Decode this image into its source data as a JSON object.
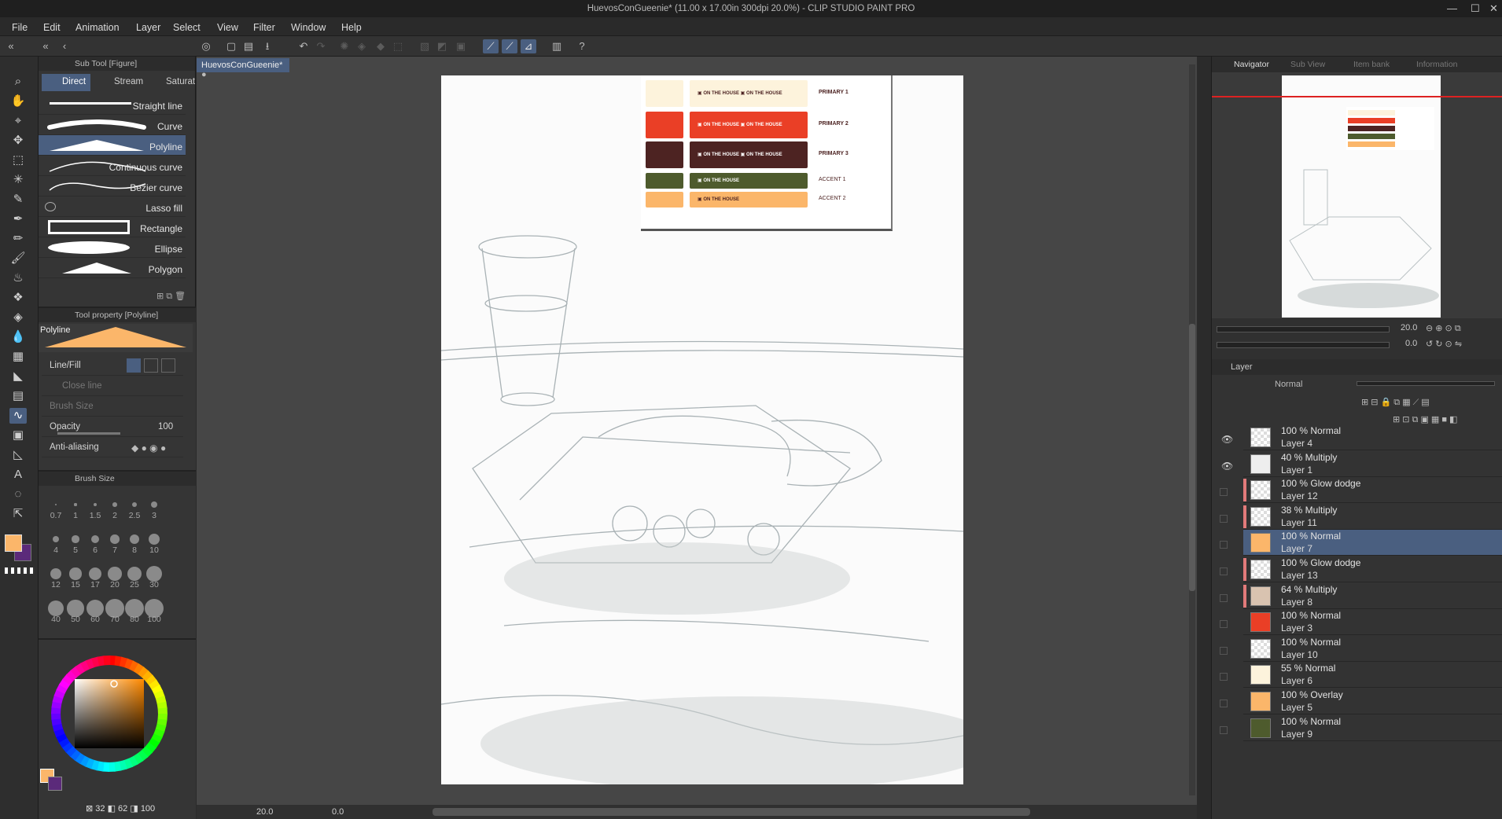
{
  "window": {
    "title": "HuevosConGueenie* (11.00 x 17.00in 300dpi 20.0%) - CLIP STUDIO PAINT PRO"
  },
  "menu": [
    "File",
    "Edit",
    "Animation",
    "Layer",
    "Select",
    "View",
    "Filter",
    "Window",
    "Help"
  ],
  "subtool": {
    "title": "Sub Tool [Figure]",
    "tabs": [
      "Direct",
      "Stream",
      "Saturat"
    ],
    "items": [
      "Straight line",
      "Curve",
      "Polyline",
      "Continuous curve",
      "Bezier curve",
      "Lasso fill",
      "Rectangle",
      "Ellipse",
      "Polygon"
    ]
  },
  "tool_property": {
    "title": "Tool property [Polyline]",
    "preview_label": "Polyline",
    "line_fill_label": "Line/Fill",
    "close_line_label": "Close line",
    "brush_size_label": "Brush Size",
    "opacity_label": "Opacity",
    "opacity_value": "100",
    "antialiasing_label": "Anti-aliasing"
  },
  "brush_size": {
    "title": "Brush Size",
    "sizes": [
      "0.7",
      "1",
      "1.5",
      "2",
      "2.5",
      "3",
      "4",
      "5",
      "6",
      "7",
      "8",
      "10",
      "12",
      "15",
      "17",
      "20",
      "25",
      "30",
      "40",
      "50",
      "60",
      "70",
      "80",
      "100"
    ]
  },
  "color": {
    "main": "#fbb66a",
    "sub": "#5b2a7a",
    "readout": {
      "h": "32",
      "s": "62",
      "v": "100"
    }
  },
  "document": {
    "tab": "HuevosConGueenie*",
    "zoom": "20.0",
    "rotation": "0.0"
  },
  "palette_sheet": {
    "rows": [
      {
        "label": "PRIMARY 1",
        "swatch": "#fdf3dc"
      },
      {
        "label": "PRIMARY 2",
        "swatch": "#ea3f26"
      },
      {
        "label": "PRIMARY 3",
        "swatch": "#4d2322"
      },
      {
        "label": "ACCENT 1",
        "swatch": "#4e5b2d"
      },
      {
        "label": "ACCENT 2",
        "swatch": "#fbb66a"
      }
    ],
    "logo_text": "ON THE HOUSE"
  },
  "navigator": {
    "tabs": [
      "Navigator",
      "Sub View",
      "Item bank",
      "Information"
    ],
    "zoom": "20.0",
    "rotation": "0.0"
  },
  "layer_panel": {
    "title": "Layer",
    "blend_mode": "Normal",
    "layers": [
      {
        "mode": "100 % Normal",
        "name": "Layer 4",
        "visible": true
      },
      {
        "mode": "40 % Multiply",
        "name": "Layer 1",
        "visible": true
      },
      {
        "mode": "100 % Glow dodge",
        "name": "Layer 12",
        "visible": false
      },
      {
        "mode": "38 % Multiply",
        "name": "Layer 11",
        "visible": false
      },
      {
        "mode": "100 % Normal",
        "name": "Layer 7",
        "visible": false
      },
      {
        "mode": "100 % Glow dodge",
        "name": "Layer 13",
        "visible": false
      },
      {
        "mode": "64 % Multiply",
        "name": "Layer 8",
        "visible": false
      },
      {
        "mode": "100 % Normal",
        "name": "Layer 3",
        "visible": false
      },
      {
        "mode": "100 % Normal",
        "name": "Layer 10",
        "visible": false
      },
      {
        "mode": "55 % Normal",
        "name": "Layer 6",
        "visible": false
      },
      {
        "mode": "100 % Overlay",
        "name": "Layer 5",
        "visible": false
      },
      {
        "mode": "100 % Normal",
        "name": "Layer 9",
        "visible": false
      }
    ]
  }
}
